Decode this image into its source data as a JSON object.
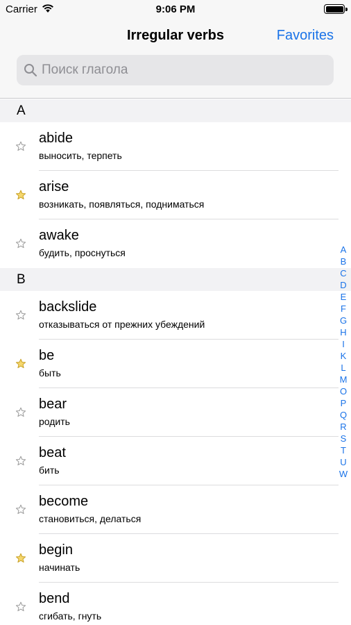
{
  "status_bar": {
    "carrier": "Carrier",
    "time": "9:06 PM"
  },
  "nav": {
    "title": "Irregular verbs",
    "favorites_label": "Favorites"
  },
  "search": {
    "placeholder": "Поиск глагола",
    "value": ""
  },
  "sections": [
    {
      "letter": "A",
      "items": [
        {
          "verb": "abide",
          "translation": "выносить, терпеть",
          "favorite": false
        },
        {
          "verb": "arise",
          "translation": "возникать, появляться, подниматься",
          "favorite": true
        },
        {
          "verb": "awake",
          "translation": "будить, проснуться",
          "favorite": false
        }
      ]
    },
    {
      "letter": "B",
      "items": [
        {
          "verb": "backslide",
          "translation": "отказываться от прежних убеждений",
          "favorite": false
        },
        {
          "verb": "be",
          "translation": "быть",
          "favorite": true
        },
        {
          "verb": "bear",
          "translation": "родить",
          "favorite": false
        },
        {
          "verb": "beat",
          "translation": "бить",
          "favorite": false
        },
        {
          "verb": "become",
          "translation": "становиться, делаться",
          "favorite": false
        },
        {
          "verb": "begin",
          "translation": "начинать",
          "favorite": true
        },
        {
          "verb": "bend",
          "translation": "сгибать, гнуть",
          "favorite": false
        }
      ]
    }
  ],
  "index_letters": [
    "A",
    "B",
    "C",
    "D",
    "E",
    "F",
    "G",
    "H",
    "I",
    "K",
    "L",
    "M",
    "O",
    "P",
    "Q",
    "R",
    "S",
    "T",
    "U",
    "W"
  ],
  "colors": {
    "accent": "#1a73e8",
    "star_fill": "#f5d76e",
    "star_outline": "#9a9a9a"
  }
}
